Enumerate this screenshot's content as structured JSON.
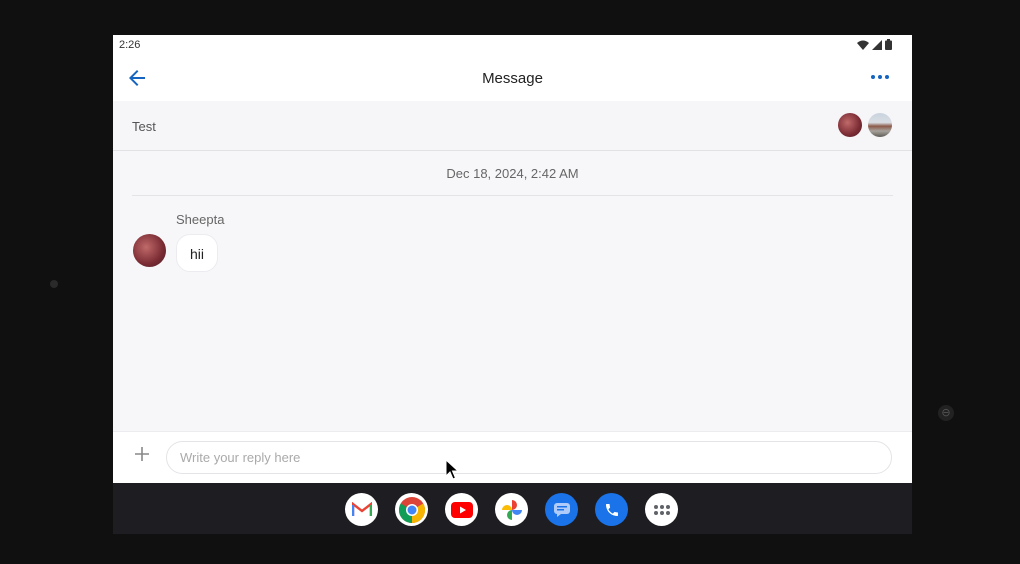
{
  "status_bar": {
    "time": "2:26"
  },
  "app_bar": {
    "title": "Message"
  },
  "conversation": {
    "name": "Test"
  },
  "thread": {
    "date_divider": "Dec 18, 2024, 2:42 AM",
    "messages": [
      {
        "sender": "Sheepta",
        "text": "hii"
      }
    ]
  },
  "composer": {
    "placeholder": "Write your reply here",
    "value": ""
  },
  "dock": {
    "apps": [
      "gmail-icon",
      "chrome-icon",
      "youtube-icon",
      "photos-icon",
      "messages-icon",
      "phone-icon",
      "app-drawer-icon"
    ]
  },
  "colors": {
    "accent": "#1565c0",
    "background": "#f7f7f9",
    "dock": "#1e1e22"
  }
}
